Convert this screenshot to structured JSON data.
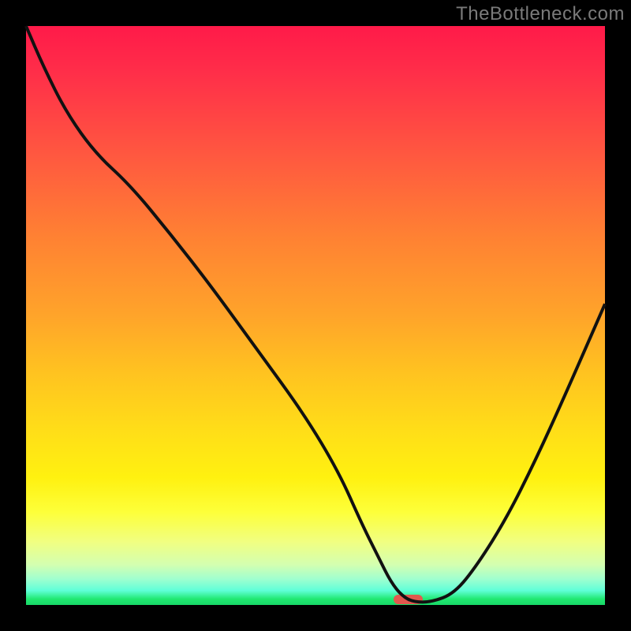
{
  "watermark": "TheBottleneck.com",
  "colors": {
    "frame": "#000000",
    "curve": "#111111",
    "marker": "#e2584e"
  },
  "chart_data": {
    "type": "line",
    "title": "",
    "xlabel": "",
    "ylabel": "",
    "xlim": [
      0,
      100
    ],
    "ylim": [
      0,
      100
    ],
    "x": [
      0,
      3,
      7,
      12,
      18,
      25,
      32,
      40,
      48,
      54,
      58,
      61,
      63,
      65,
      67,
      70,
      74,
      78,
      83,
      88,
      93,
      100
    ],
    "values": [
      100,
      93,
      85,
      78,
      72.5,
      64,
      55,
      44,
      33,
      23,
      14,
      8,
      4,
      1.5,
      0.5,
      0.5,
      2,
      7,
      15,
      25,
      36,
      52
    ],
    "marker": {
      "x": 66,
      "y": 0.2,
      "width": 5,
      "height": 1.6
    }
  }
}
